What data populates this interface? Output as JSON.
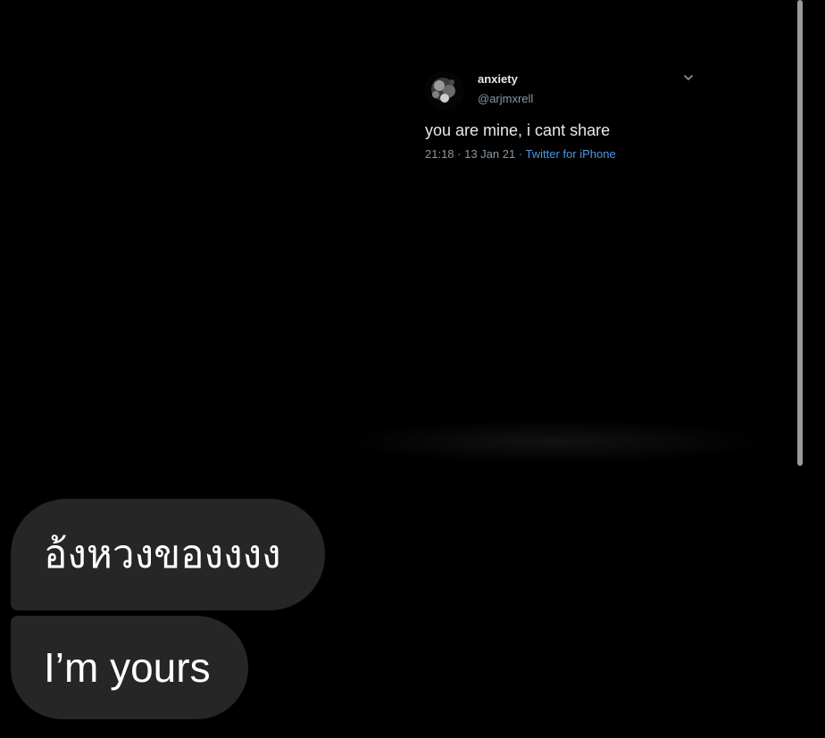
{
  "tweet": {
    "name": "anxiety",
    "handle": "@arjmxrell",
    "text": "you are mine, i cant share",
    "time": "21:18 · 13 Jan 21 · ",
    "source": "Twitter for iPhone",
    "avatar_icon": "profile-photo",
    "menu_icon": "chevron-down-icon"
  },
  "messages": [
    {
      "text": "อ้งหวงของงงง"
    },
    {
      "text": "I’m yours"
    }
  ],
  "colors": {
    "background": "#000000",
    "bubble": "#262626",
    "link": "#4a99e9",
    "secondary_text": "#8b98a5"
  }
}
